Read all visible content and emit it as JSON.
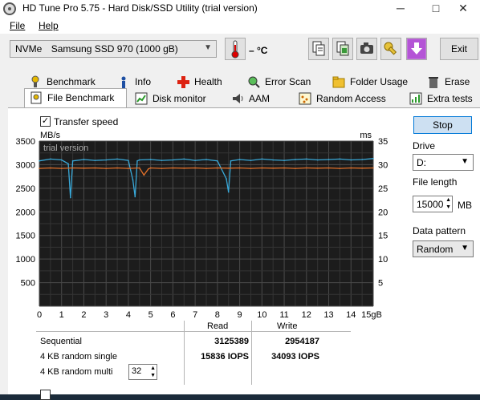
{
  "window": {
    "title": "HD Tune Pro 5.75 - Hard Disk/SSD Utility (trial version)",
    "controls": {
      "minimize": "─",
      "maximize": "□",
      "close": "✕"
    }
  },
  "menu": {
    "file": "File",
    "help": "Help"
  },
  "toolbar": {
    "device_type": "NVMe",
    "device_name": "Samsung SSD 970 (1000 gB)",
    "temperature": "– °C",
    "exit_label": "Exit"
  },
  "tabs_top": [
    {
      "label": "Benchmark",
      "icon": "benchmark-icon"
    },
    {
      "label": "Info",
      "icon": "info-icon"
    },
    {
      "label": "Health",
      "icon": "health-icon"
    },
    {
      "label": "Error Scan",
      "icon": "error-scan-icon"
    },
    {
      "label": "Folder Usage",
      "icon": "folder-icon"
    },
    {
      "label": "Erase",
      "icon": "erase-icon"
    }
  ],
  "tabs_bottom": [
    {
      "label": "File Benchmark",
      "icon": "file-benchmark-icon",
      "active": true
    },
    {
      "label": "Disk monitor",
      "icon": "disk-monitor-icon"
    },
    {
      "label": "AAM",
      "icon": "speaker-icon"
    },
    {
      "label": "Random Access",
      "icon": "random-access-icon"
    },
    {
      "label": "Extra tests",
      "icon": "extra-tests-icon"
    }
  ],
  "panel": {
    "transfer_speed_label": "Transfer speed",
    "transfer_speed_checked": true,
    "bottom_checkbox_checked": false
  },
  "right": {
    "stop_label": "Stop",
    "drive_label": "Drive",
    "drive_value": "D:",
    "file_length_label": "File length",
    "file_length_value": "15000",
    "file_length_unit": "MB",
    "pattern_label": "Data pattern",
    "pattern_value": "Random"
  },
  "results": {
    "headers": {
      "read": "Read",
      "write": "Write"
    },
    "rows": [
      {
        "label": "Sequential",
        "read": "3125389",
        "write": "2954187"
      },
      {
        "label": "4 KB random single",
        "read": "15836 IOPS",
        "write": "34093 IOPS"
      },
      {
        "label": "4 KB random multi",
        "read": "",
        "write": ""
      }
    ],
    "queue_depth": "32"
  },
  "chart_data": {
    "type": "line",
    "watermark": "trial version",
    "ylabel_left": "MB/s",
    "ylabel_right": "ms",
    "xlabel_unit": "gB",
    "xlim": [
      0,
      15
    ],
    "ylim_left": [
      0,
      3500
    ],
    "ylim_right": [
      0,
      35
    ],
    "x_ticks": [
      "0",
      "1",
      "2",
      "3",
      "4",
      "5",
      "6",
      "7",
      "8",
      "9",
      "10",
      "11",
      "12",
      "13",
      "14",
      "15gB"
    ],
    "y_ticks_left": [
      "3500",
      "3000",
      "2500",
      "2000",
      "1500",
      "1000",
      "500"
    ],
    "y_ticks_right": [
      "35",
      "30",
      "25",
      "20",
      "15",
      "10",
      "5"
    ],
    "grid": true,
    "background": "#1c1c1c",
    "series": [
      {
        "color": "#39a9d9",
        "x": [
          0,
          0.5,
          1.0,
          1.3,
          1.4,
          1.5,
          2.0,
          2.5,
          3.0,
          3.5,
          4.0,
          4.2,
          4.3,
          4.4,
          4.5,
          5.0,
          5.5,
          6.0,
          6.5,
          7.0,
          7.5,
          8.0,
          8.4,
          8.5,
          8.6,
          9.0,
          9.5,
          10.0,
          10.5,
          11.0,
          11.5,
          12.0,
          12.5,
          13.0,
          13.5,
          14.0,
          14.5,
          15.0
        ],
        "values": [
          3080,
          3120,
          3100,
          3020,
          2300,
          3080,
          3110,
          3090,
          3100,
          3120,
          3090,
          2680,
          2320,
          3080,
          3100,
          3110,
          3090,
          3100,
          3120,
          3090,
          3110,
          3080,
          2700,
          2420,
          3080,
          3110,
          3090,
          3120,
          3100,
          3090,
          3110,
          3120,
          3100,
          3110,
          3120,
          3100,
          3110,
          3130
        ]
      },
      {
        "color": "#e0702a",
        "x": [
          0,
          0.5,
          1.0,
          1.5,
          2.0,
          2.5,
          3.0,
          3.5,
          4.0,
          4.5,
          4.7,
          4.9,
          5.0,
          5.5,
          6.0,
          6.5,
          7.0,
          7.5,
          8.0,
          8.5,
          9.0,
          9.5,
          10.0,
          10.5,
          11.0,
          11.5,
          12.0,
          12.5,
          13.0,
          13.5,
          14.0,
          14.5,
          15.0
        ],
        "values": [
          2920,
          2930,
          2920,
          2930,
          2925,
          2930,
          2920,
          2930,
          2920,
          2930,
          2780,
          2910,
          2930,
          2920,
          2930,
          2925,
          2930,
          2920,
          2930,
          2925,
          2930,
          2920,
          2930,
          2925,
          2930,
          2920,
          2930,
          2925,
          2930,
          2920,
          2930,
          2925,
          2930
        ]
      }
    ]
  }
}
